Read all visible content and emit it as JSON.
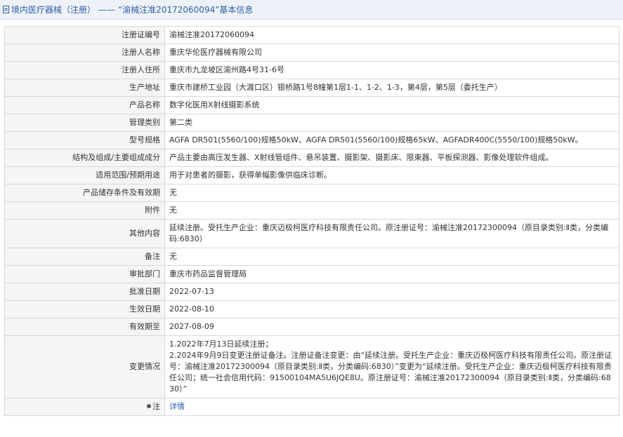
{
  "header": {
    "category": "境内医疗器械（注册）",
    "separator": "——",
    "title": "“渝械注准20172060094”基本信息"
  },
  "rows": [
    {
      "label": "注册证编号",
      "value": "渝械注准20172060094"
    },
    {
      "label": "注册人名称",
      "value": "重庆华伦医疗器械有限公司"
    },
    {
      "label": "注册人住所",
      "value": "重庆市九龙坡区渝州路4号31-6号"
    },
    {
      "label": "生产地址",
      "value": "重庆市建桥工业园（大渡口区）银桥路1号8幢第1层1-1、1-2、1-3，第4层，第5层（委托生产）"
    },
    {
      "label": "产品名称",
      "value": "数字化医用X射线摄影系统"
    },
    {
      "label": "管理类别",
      "value": "第二类"
    },
    {
      "label": "型号规格",
      "value": "AGFA DR501(5560/100)规格50kW、AGFA DR501(5560/100)规格65kW、AGFADR400C(5550/100)规格50kW。"
    },
    {
      "label": "结构及组成/主要组成成分",
      "value": "产品主要由高压发生器、X射线管组件、悬吊装置、摄影架、摄影床、限束器、平板探测器、影像处理软件组成。"
    },
    {
      "label": "适用范围/预期用途",
      "value": "用于对患者的摄影，获得单幅影像供临床诊断。"
    },
    {
      "label": "产品储存条件及有效期",
      "value": "无"
    },
    {
      "label": "附件",
      "value": "无"
    },
    {
      "label": "其他内容",
      "value": "延续注册。受托生产企业：重庆迈极柯医疗科技有限责任公司。原注册证号：渝械注准20172300094（原目录类别:Ⅱ类，分类编码:6830）"
    },
    {
      "label": "备注",
      "value": "无"
    },
    {
      "label": "审批部门",
      "value": "重庆市药品监督管理局"
    },
    {
      "label": "批准日期",
      "value": "2022-07-13"
    },
    {
      "label": "生效日期",
      "value": "2022-08-10"
    },
    {
      "label": "有效期至",
      "value": "2027-08-09"
    }
  ],
  "change_row": {
    "label": "变更情况",
    "line1": "1.2022年7月13日延续注册；",
    "line2": "2.2024年9月9日变更注册证备注。注册证备注变更：由“延续注册。受托生产企业：重庆迈极柯医疗科技有限责任公司。原注册证号：渝械注准20172300094（原目录类别:Ⅱ类，分类编码:6830）”变更为“延续注册。受托生产企业：重庆迈极柯医疗科技有限责任公司；统一社会信用代码：91500104MA5U6JQE8U。原注册证号：渝械注准20172300094（原目录类别:Ⅱ类，分类编码:6830）”"
  },
  "note_row": {
    "label": "注",
    "link": "详情",
    "icon": "location-pin-icon"
  },
  "colors": {
    "accent": "#2d5fa8",
    "label_bg": "#f5f5f5",
    "border": "#d9d9d9",
    "header_bg": "#eef2f8"
  }
}
